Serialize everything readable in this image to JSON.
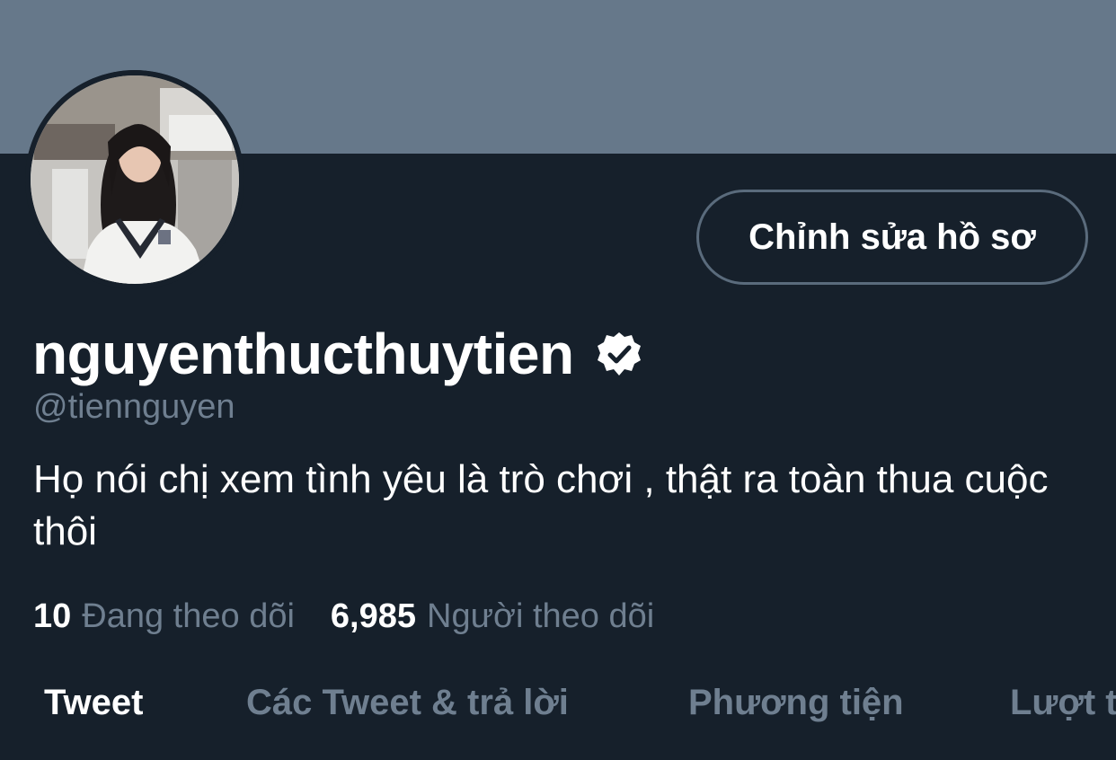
{
  "profile": {
    "edit_button": "Chỉnh sửa hồ sơ",
    "display_name": "nguyenthucthuytien",
    "handle": "@tiennguyen",
    "bio": "Họ nói chị xem tình yêu là trò chơi , thật ra toàn thua cuộc thôi",
    "verified_icon": "verified-badge-icon"
  },
  "stats": {
    "following_count": "10",
    "following_label": "Đang theo dõi",
    "followers_count": "6,985",
    "followers_label": "Người theo dõi"
  },
  "tabs": [
    {
      "label": "Tweet",
      "active": true
    },
    {
      "label": "Các Tweet & trả lời",
      "active": false
    },
    {
      "label": "Phương tiện",
      "active": false
    },
    {
      "label": "Lượt thích",
      "active": false
    }
  ],
  "colors": {
    "background": "#16202b",
    "banner": "#66788a",
    "muted_text": "#6f7f90",
    "button_border": "#5a6b7c"
  }
}
